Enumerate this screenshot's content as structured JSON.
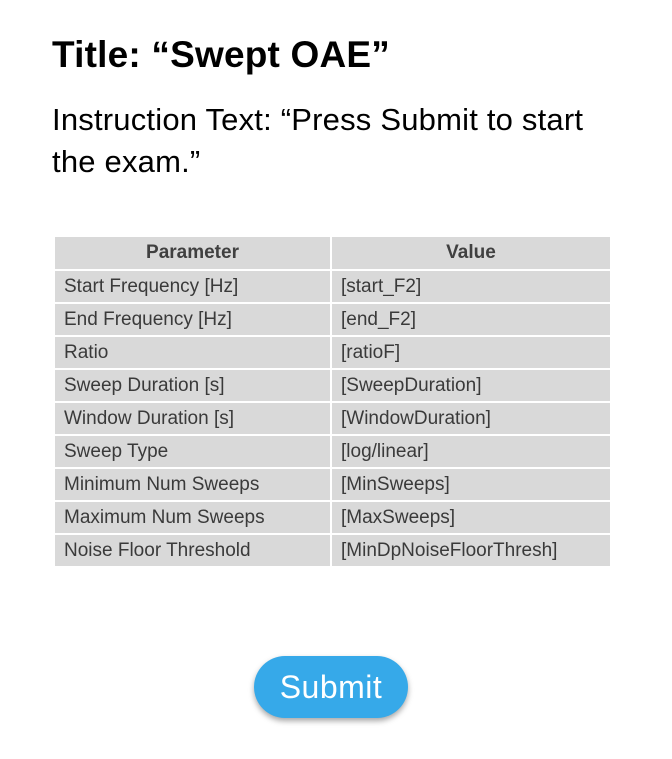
{
  "title": "Title: “Swept OAE”",
  "instruction": "Instruction Text: “Press Submit to start the exam.”",
  "table": {
    "headers": [
      "Parameter",
      "Value"
    ],
    "rows": [
      [
        "Start Frequency [Hz]",
        "[start_F2]"
      ],
      [
        "End Frequency [Hz]",
        "[end_F2]"
      ],
      [
        "Ratio",
        "[ratioF]"
      ],
      [
        "Sweep Duration [s]",
        "[SweepDuration]"
      ],
      [
        "Window Duration [s]",
        "[WindowDuration]"
      ],
      [
        "Sweep Type",
        "[log/linear]"
      ],
      [
        "Minimum Num Sweeps",
        "[MinSweeps]"
      ],
      [
        "Maximum Num Sweeps",
        "[MaxSweeps]"
      ],
      [
        "Noise Floor Threshold",
        "[MinDpNoiseFloorThresh]"
      ]
    ]
  },
  "submit_label": "Submit",
  "colors": {
    "submit_button": "#36a9e9",
    "table_cell": "#d9d9d9"
  }
}
